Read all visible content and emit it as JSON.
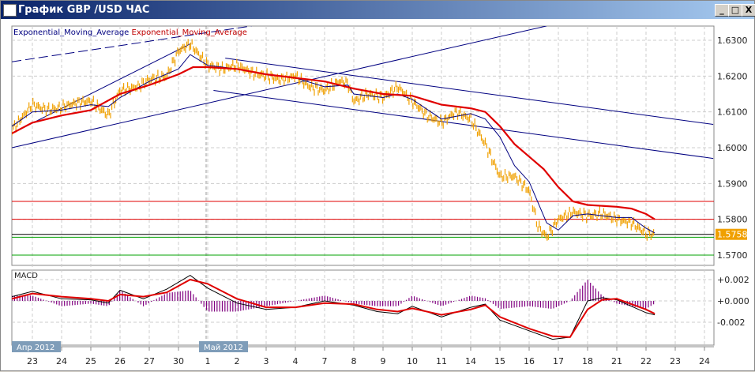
{
  "window": {
    "title": "График GBP /USD  ЧАС",
    "min": "_",
    "max": "□",
    "close": "X"
  },
  "legend": {
    "ema_fast": "Exponential_Moving_Average",
    "ema_slow": "Exponential_Moving_Average"
  },
  "macd_label": "MACD",
  "month_labels": [
    "Апр 2012",
    "Май 2012"
  ],
  "colors": {
    "price": "#f0a000",
    "ema_fast": "#000080",
    "ema_slow": "#e00000",
    "macd": "#000000",
    "signal": "#e00000",
    "hist": "#800080"
  },
  "chart_data": {
    "type": "line",
    "x_ticks": [
      "23",
      "24",
      "25",
      "26",
      "27",
      "30",
      "1",
      "2",
      "3",
      "4",
      "7",
      "8",
      "9",
      "10",
      "11",
      "14",
      "15",
      "16",
      "17",
      "18",
      "21",
      "22",
      "23",
      "24"
    ],
    "y_ticks": [
      "1.6300",
      "1.6200",
      "1.6100",
      "1.6000",
      "1.5900",
      "1.5800",
      "1.5700"
    ],
    "ylim": [
      1.566,
      1.634
    ],
    "current_price": "1.5758",
    "price": {
      "x": [
        -0.7,
        0,
        0.5,
        0.9,
        1.5,
        2,
        2.6,
        3,
        3.6,
        4,
        4.6,
        5,
        5.4,
        6,
        6.5,
        7,
        7.5,
        8,
        8.5,
        9,
        9.5,
        10,
        10.5,
        10.8,
        11,
        11.5,
        12,
        12.5,
        13,
        13.5,
        14,
        14.5,
        15,
        15.5,
        16,
        16.5,
        17,
        17.3,
        17.6,
        18,
        18.5,
        19,
        19.5,
        20,
        20.5,
        21,
        21.3
      ],
      "y": [
        1.605,
        1.612,
        1.6105,
        1.611,
        1.6125,
        1.613,
        1.609,
        1.616,
        1.617,
        1.619,
        1.62,
        1.627,
        1.629,
        1.623,
        1.622,
        1.623,
        1.621,
        1.62,
        1.619,
        1.62,
        1.617,
        1.616,
        1.6185,
        1.618,
        1.613,
        1.615,
        1.614,
        1.617,
        1.613,
        1.609,
        1.607,
        1.61,
        1.608,
        1.601,
        1.592,
        1.592,
        1.588,
        1.578,
        1.575,
        1.58,
        1.582,
        1.581,
        1.5815,
        1.58,
        1.579,
        1.576,
        1.5758
      ]
    },
    "ema_fast": {
      "x": [
        -0.7,
        0,
        1,
        2,
        2.6,
        3,
        4,
        5,
        5.4,
        6,
        7,
        8,
        9,
        10,
        10.8,
        11,
        12,
        12.5,
        13,
        14,
        15,
        15.5,
        16,
        16.5,
        17,
        17.6,
        18,
        18.5,
        19,
        20,
        20.5,
        21,
        21.3
      ],
      "y": [
        1.606,
        1.61,
        1.6105,
        1.612,
        1.6115,
        1.614,
        1.6185,
        1.622,
        1.626,
        1.623,
        1.622,
        1.6205,
        1.6195,
        1.617,
        1.6175,
        1.615,
        1.614,
        1.615,
        1.6135,
        1.608,
        1.6095,
        1.608,
        1.603,
        1.595,
        1.5905,
        1.579,
        1.577,
        1.581,
        1.5815,
        1.5805,
        1.5805,
        1.5775,
        1.5762
      ]
    },
    "ema_slow": {
      "x": [
        -0.7,
        0,
        1,
        2,
        3,
        4,
        5,
        5.5,
        6,
        7,
        8,
        9,
        10,
        11,
        12,
        13,
        14,
        15,
        15.5,
        16,
        16.5,
        17,
        17.5,
        18,
        18.5,
        19,
        20,
        20.5,
        21,
        21.3
      ],
      "y": [
        1.604,
        1.607,
        1.609,
        1.6105,
        1.615,
        1.6175,
        1.6205,
        1.6225,
        1.6225,
        1.622,
        1.6205,
        1.6195,
        1.6185,
        1.6165,
        1.615,
        1.6145,
        1.612,
        1.611,
        1.61,
        1.606,
        1.601,
        1.5975,
        1.594,
        1.589,
        1.585,
        1.584,
        1.5835,
        1.583,
        1.5815,
        1.58
      ]
    },
    "trend_lines": [
      {
        "style": "dashed",
        "color": "#000080",
        "from": [
          -0.7,
          1.624
        ],
        "to": [
          7.5,
          1.634
        ]
      },
      {
        "style": "solid",
        "color": "#000080",
        "from": [
          -0.7,
          1.604
        ],
        "to": [
          5.4,
          1.629
        ]
      },
      {
        "style": "solid",
        "color": "#000080",
        "from": [
          -0.7,
          1.6
        ],
        "to": [
          17.6,
          1.634
        ]
      },
      {
        "style": "solid",
        "color": "#000080",
        "from": [
          6.6,
          1.625
        ],
        "to": [
          23.3,
          1.6065
        ]
      },
      {
        "style": "solid",
        "color": "#000080",
        "from": [
          6.2,
          1.616
        ],
        "to": [
          23.3,
          1.597
        ]
      }
    ],
    "levels": [
      {
        "y": 1.585,
        "color": "#e00000"
      },
      {
        "y": 1.58,
        "color": "#e00000"
      },
      {
        "y": 1.5758,
        "color": "#000000"
      },
      {
        "y": 1.575,
        "color": "#00a000"
      },
      {
        "y": 1.57,
        "color": "#00a000"
      }
    ],
    "macd": {
      "y_ticks": [
        "+0.002",
        "+0.000",
        "-0.002"
      ],
      "ylim": [
        -0.0038,
        0.0028
      ],
      "x": [
        -0.7,
        0,
        1,
        2,
        2.6,
        3,
        3.8,
        4.6,
        5.4,
        6,
        7,
        8,
        9,
        10,
        11,
        11.8,
        12.5,
        13,
        14,
        15,
        15.5,
        16,
        17,
        17.8,
        18.4,
        19,
        19.5,
        20,
        21,
        21.3
      ],
      "macd": [
        0.0004,
        0.0009,
        0.0002,
        0.0001,
        -0.0002,
        0.001,
        0.0002,
        0.0011,
        0.0024,
        0.0012,
        -0.0002,
        -0.0008,
        -0.0006,
        0.0,
        -0.0004,
        -0.001,
        -0.0012,
        -0.0005,
        -0.0015,
        -0.0006,
        -0.0003,
        -0.0018,
        -0.0028,
        -0.0036,
        -0.0034,
        0.0,
        0.0003,
        0.0001,
        -0.0011,
        -0.0013
      ],
      "signal": [
        0.0002,
        0.0007,
        0.0004,
        0.0002,
        0.0,
        0.0006,
        0.0004,
        0.0008,
        0.002,
        0.0016,
        0.0002,
        -0.0006,
        -0.0006,
        -0.0002,
        -0.0003,
        -0.0008,
        -0.001,
        -0.0007,
        -0.0013,
        -0.0008,
        -0.0004,
        -0.0015,
        -0.0026,
        -0.0033,
        -0.0034,
        -0.0008,
        0.0001,
        0.0002,
        -0.0008,
        -0.0012
      ]
    }
  }
}
